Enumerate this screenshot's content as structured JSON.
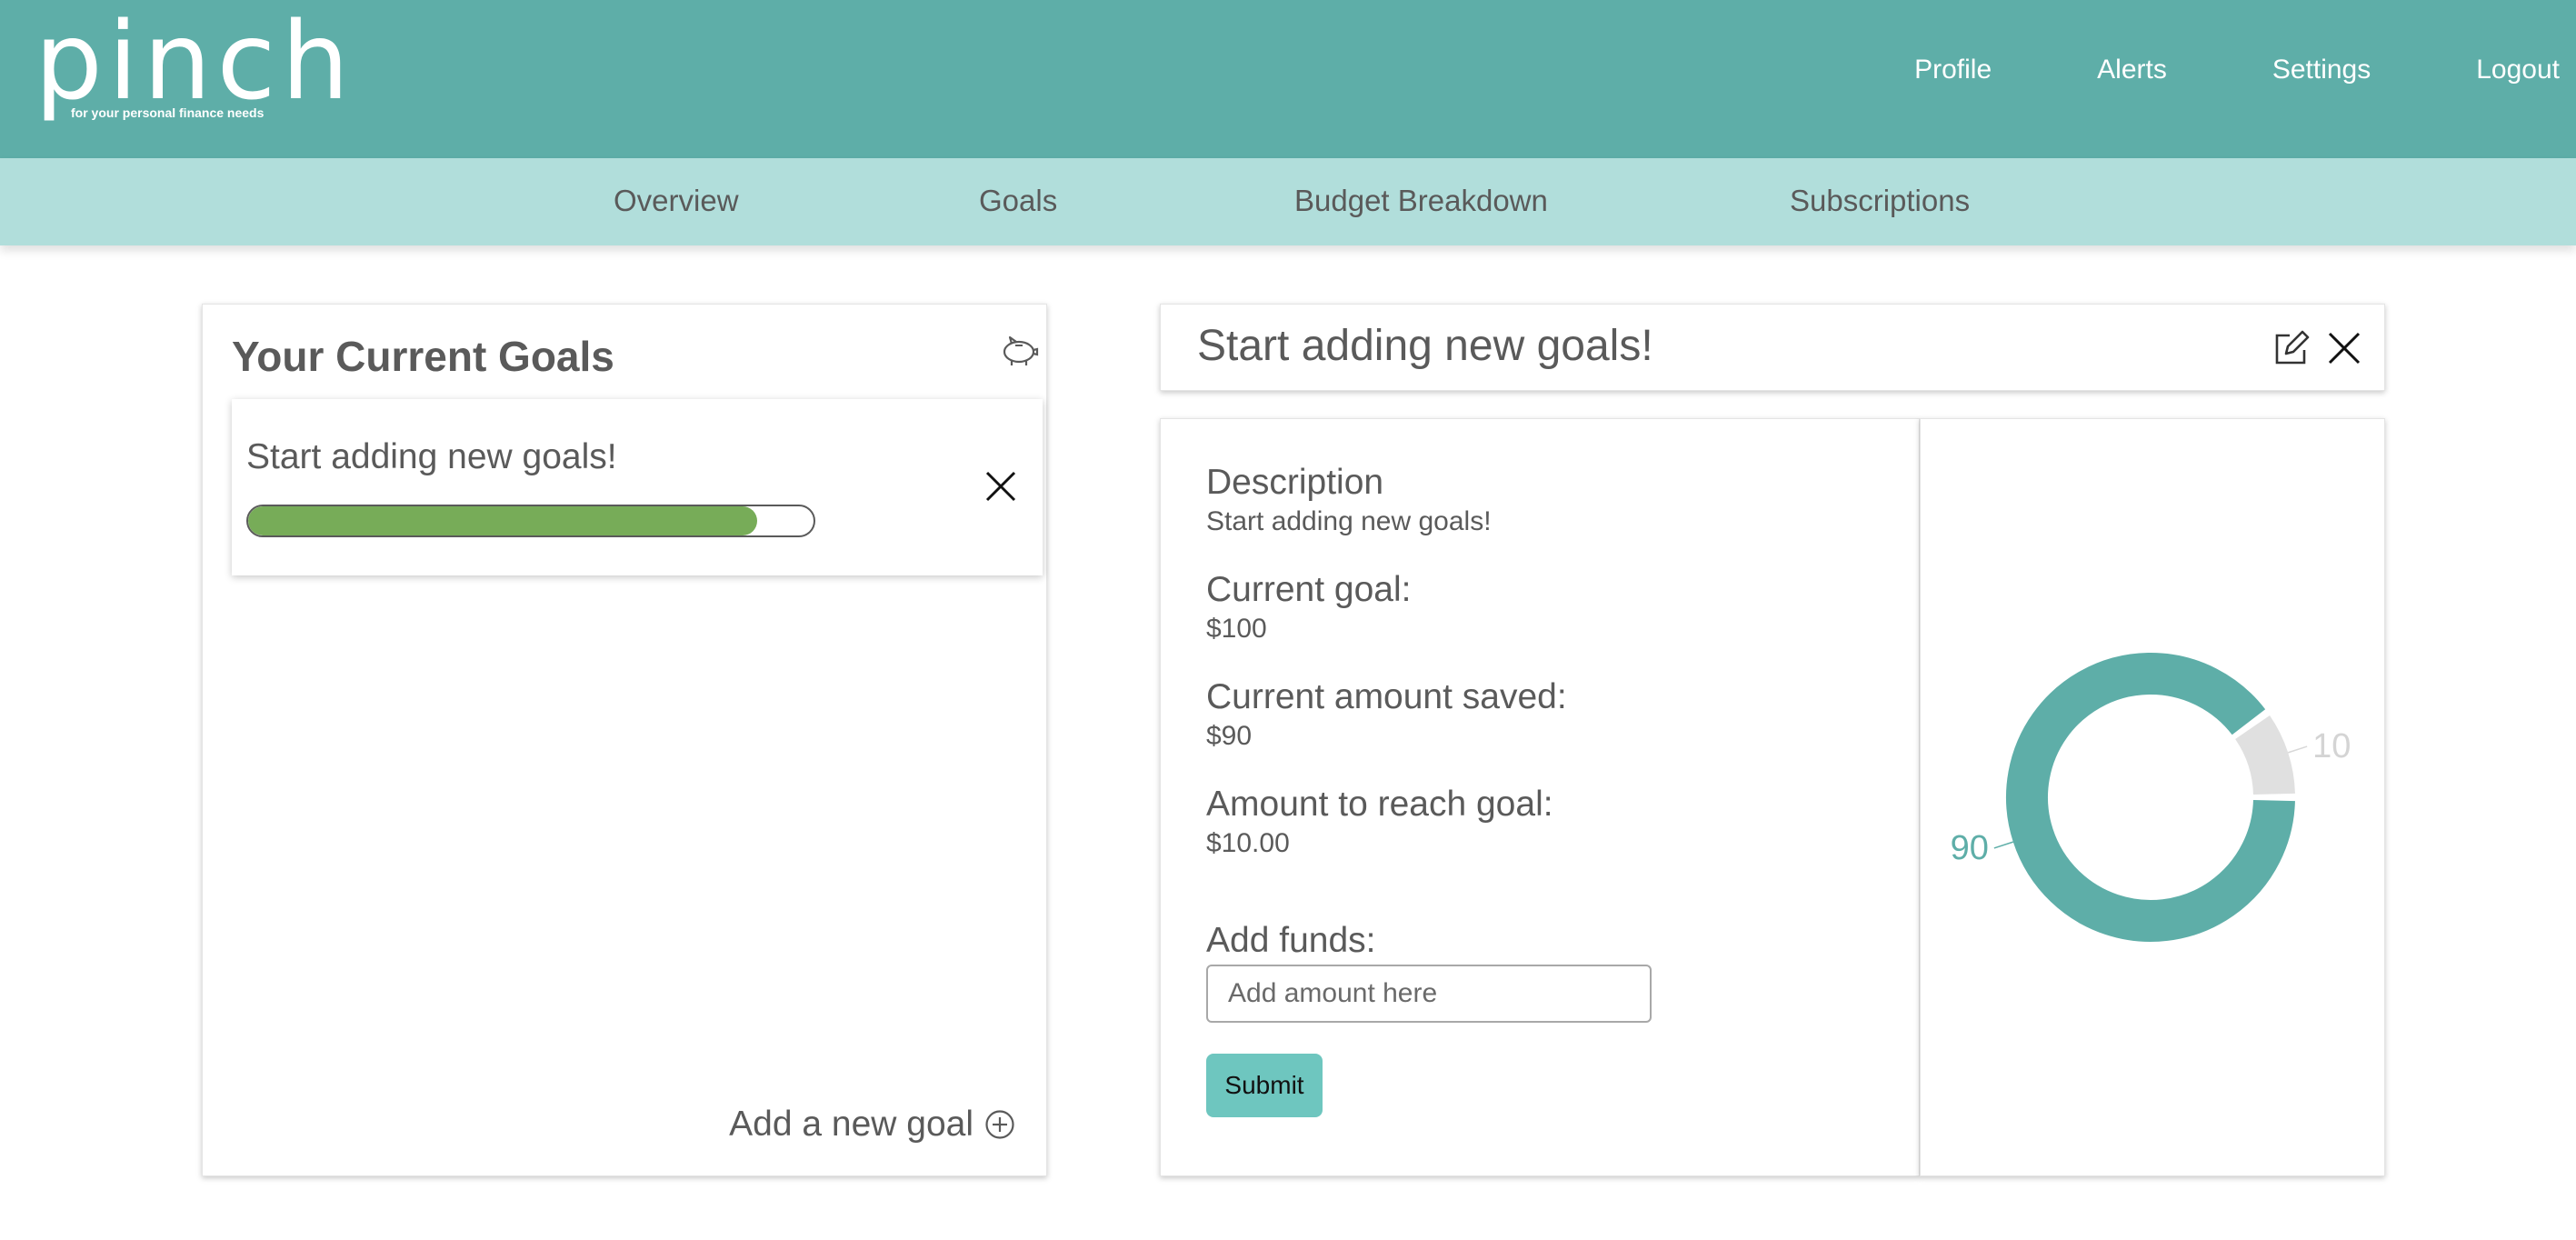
{
  "app": {
    "logo_text": "pinch",
    "logo_tagline": "for your personal finance needs"
  },
  "topnav": {
    "items": [
      {
        "label": "Profile"
      },
      {
        "label": "Alerts"
      },
      {
        "label": "Settings"
      },
      {
        "label": "Logout"
      }
    ]
  },
  "subnav": {
    "items": [
      {
        "label": "Overview"
      },
      {
        "label": "Goals"
      },
      {
        "label": "Budget Breakdown"
      },
      {
        "label": "Subscriptions"
      }
    ]
  },
  "goals_panel": {
    "title": "Your Current Goals",
    "icon": "piggy-bank-icon",
    "goals": [
      {
        "name": "Start adding new goals!",
        "progress_percent": 90
      }
    ],
    "add_goal_label": "Add a new goal"
  },
  "detail": {
    "title": "Start adding new goals!",
    "description_label": "Description",
    "description_value": "Start adding new goals!",
    "current_goal_label": "Current goal:",
    "current_goal_value": "$100",
    "saved_label": "Current amount saved:",
    "saved_value": "$90",
    "remaining_label": "Amount to reach goal:",
    "remaining_value": "$10.00",
    "add_funds_label": "Add funds:",
    "add_funds_placeholder": "Add amount here",
    "submit_label": "Submit"
  },
  "colors": {
    "topbar": "#5eaea8",
    "subnav": "#b1dedb",
    "progress_fill": "#77ac58",
    "submit": "#6ec6bf",
    "donut_saved": "#5eaea8",
    "donut_remaining": "#e0e0e0"
  },
  "chart_data": {
    "type": "pie",
    "donut": true,
    "slices": [
      {
        "label": "90",
        "value": 90,
        "color": "#5eaea8"
      },
      {
        "label": "10",
        "value": 10,
        "color": "#e0e0e0"
      }
    ]
  }
}
